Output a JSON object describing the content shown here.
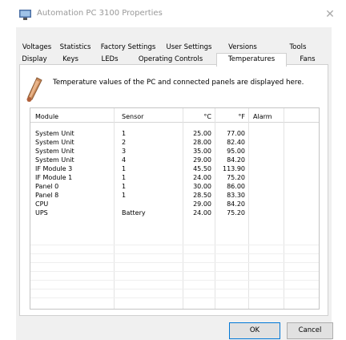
{
  "window": {
    "title": "Automation PC 3100 Properties",
    "close_glyph": "✕"
  },
  "tabs": {
    "row1": [
      "Voltages",
      "Statistics",
      "Factory Settings",
      "User Settings",
      "Versions",
      "Tools"
    ],
    "row2": [
      "Display",
      "Keys",
      "LEDs",
      "Operating Controls",
      "Temperatures",
      "Fans"
    ],
    "selected": "Temperatures"
  },
  "info": {
    "icon": "thermometer-icon",
    "text": "Temperature values of the PC and connected panels are displayed here."
  },
  "table": {
    "columns": [
      "Module",
      "Sensor",
      "°C",
      "°F",
      "Alarm"
    ],
    "rows": [
      [
        "System Unit",
        "1",
        "25.00",
        "77.00",
        ""
      ],
      [
        "System Unit",
        "2",
        "28.00",
        "82.40",
        ""
      ],
      [
        "System Unit",
        "3",
        "35.00",
        "95.00",
        ""
      ],
      [
        "System Unit",
        "4",
        "29.00",
        "84.20",
        ""
      ],
      [
        "IF Module 3",
        "1",
        "45.50",
        "113.90",
        ""
      ],
      [
        "IF Module 1",
        "1",
        "24.00",
        "75.20",
        ""
      ],
      [
        "Panel 0",
        "1",
        "30.00",
        "86.00",
        ""
      ],
      [
        "Panel 8",
        "1",
        "28.50",
        "83.30",
        ""
      ],
      [
        "CPU",
        "",
        "29.00",
        "84.20",
        ""
      ],
      [
        "UPS",
        "Battery",
        "24.00",
        "75.20",
        ""
      ]
    ]
  },
  "buttons": {
    "ok": "OK",
    "cancel": "Cancel"
  },
  "colors": {
    "dialog_bg": "#f0f0f0",
    "default_button_border": "#0078d7",
    "title_text": "#999999"
  }
}
